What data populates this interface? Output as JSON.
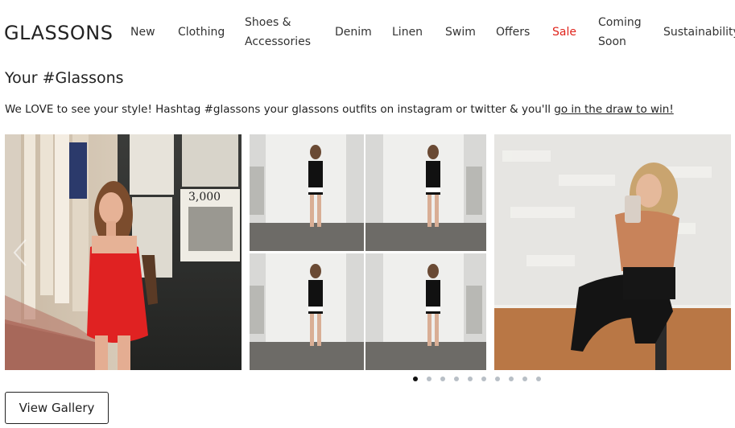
{
  "brand": {
    "logo_text": "GLASSONS"
  },
  "nav": {
    "items": [
      {
        "label": "New"
      },
      {
        "label": "Clothing"
      },
      {
        "line1": "Shoes &",
        "line2": "Accessories"
      },
      {
        "label": "Denim"
      },
      {
        "label": "Linen"
      },
      {
        "label": "Swim"
      },
      {
        "label": "Offers"
      },
      {
        "label": "Sale",
        "color": "#e0241c"
      },
      {
        "line1": "Coming",
        "line2": "Soon"
      },
      {
        "label": "Sustainability"
      }
    ]
  },
  "section": {
    "title": "Your #Glassons",
    "intro_text": "We LOVE to see your style! Hashtag #glassons your glassons outfits on instagram or twitter & you'll ",
    "intro_link": "go in the draw to win!"
  },
  "gallery": {
    "tiles": [
      {
        "name": "photo-red-dress"
      },
      {
        "name": "photo-black-dress-grid"
      },
      {
        "name": "photo-orange-top"
      }
    ],
    "carousel": {
      "total": 10,
      "active": 1
    }
  },
  "actions": {
    "view_gallery_label": "View Gallery"
  }
}
